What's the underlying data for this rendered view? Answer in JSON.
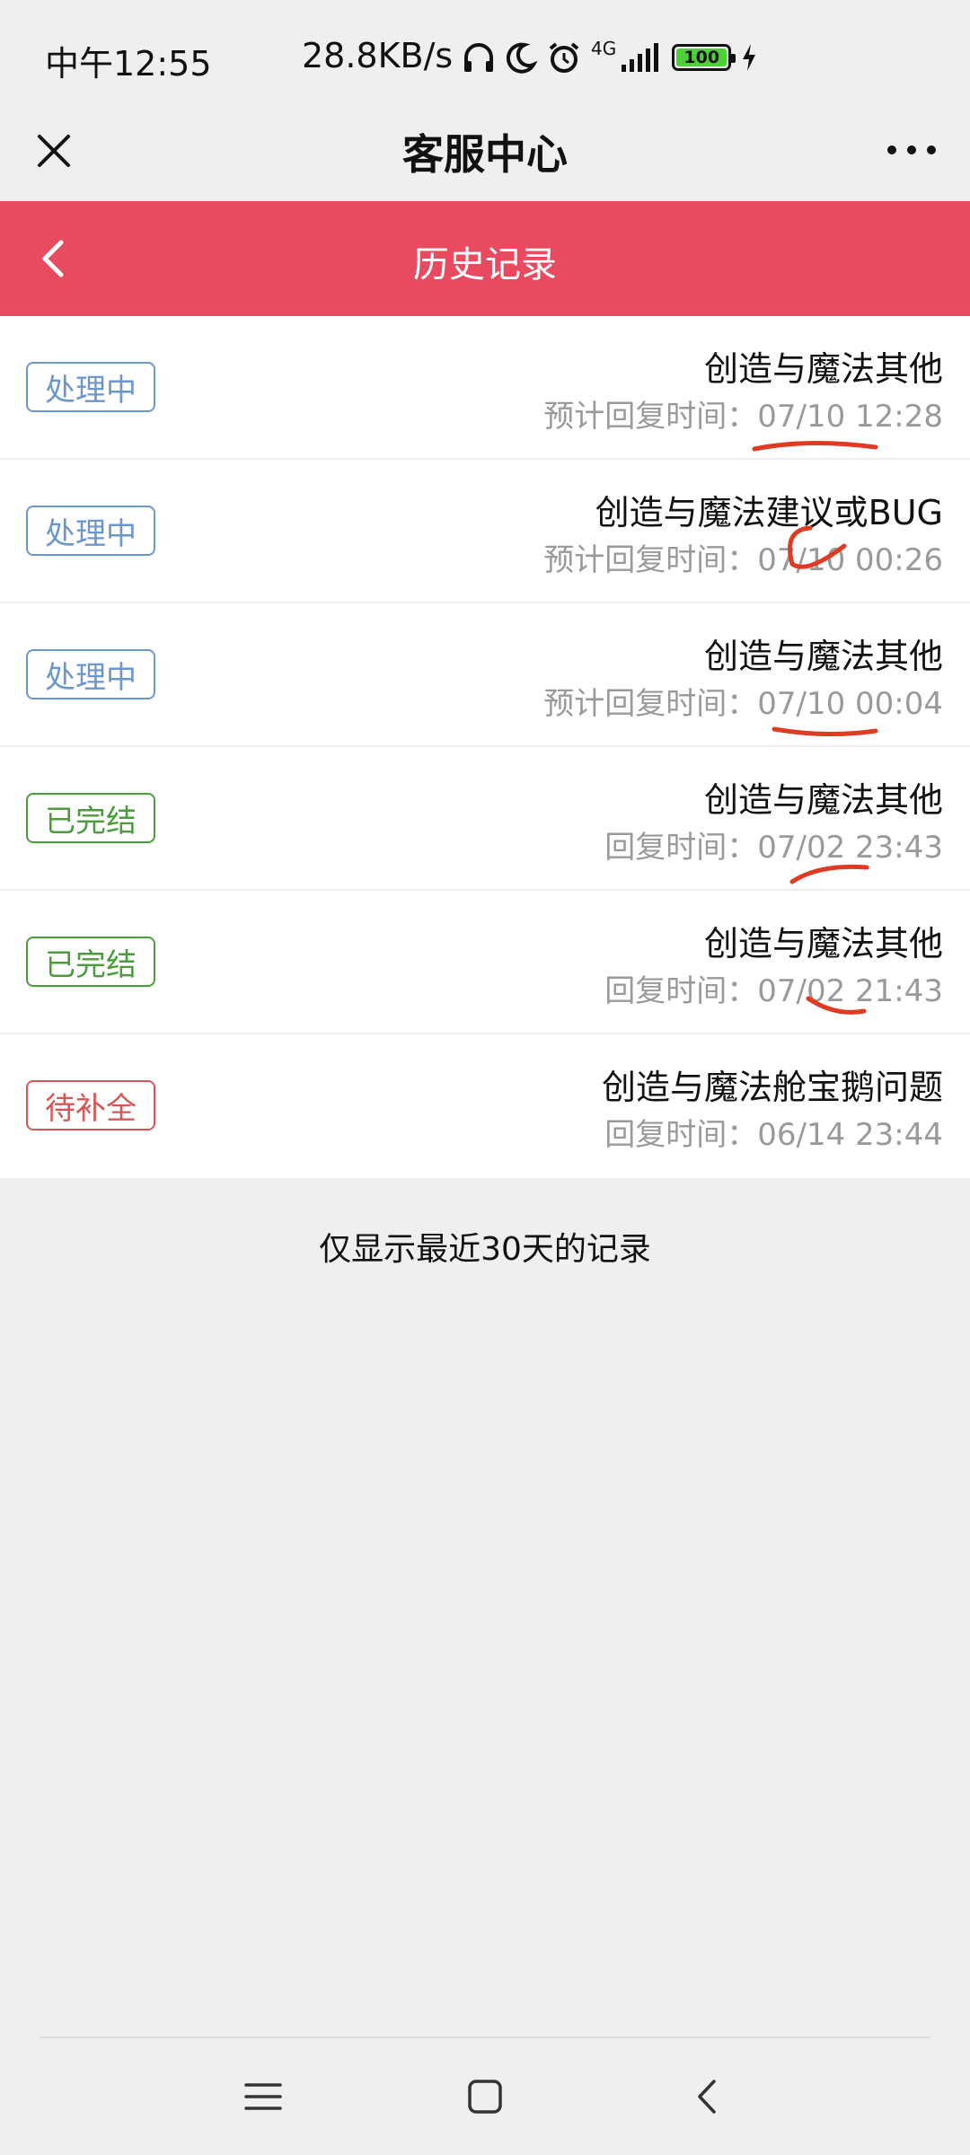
{
  "status_bar": {
    "time": "中午12:55",
    "speed": "28.8KB/s",
    "network": "4G",
    "battery": "100"
  },
  "nav": {
    "title": "客服中心"
  },
  "header": {
    "title": "历史记录"
  },
  "tickets": [
    {
      "status": "处理中",
      "status_type": "processing",
      "title": "创造与魔法其他",
      "reply_label": "预计回复时间：",
      "reply_time": "07/10 12:28"
    },
    {
      "status": "处理中",
      "status_type": "processing",
      "title": "创造与魔法建议或BUG",
      "reply_label": "预计回复时间：",
      "reply_time": "07/10 00:26"
    },
    {
      "status": "处理中",
      "status_type": "processing",
      "title": "创造与魔法其他",
      "reply_label": "预计回复时间：",
      "reply_time": "07/10 00:04"
    },
    {
      "status": "已完结",
      "status_type": "done",
      "title": "创造与魔法其他",
      "reply_label": "回复时间：",
      "reply_time": "07/02 23:43"
    },
    {
      "status": "已完结",
      "status_type": "done",
      "title": "创造与魔法其他",
      "reply_label": "回复时间：",
      "reply_time": "07/02 21:43"
    },
    {
      "status": "待补全",
      "status_type": "pending",
      "title": "创造与魔法舱宝鹅问题",
      "reply_label": "回复时间：",
      "reply_time": "06/14 23:44"
    }
  ],
  "footer_note": "仅显示最近30天的记录",
  "colors": {
    "header_bg": "#e84a5f",
    "processing": "#6b97d1",
    "done": "#4a9e3a",
    "pending": "#d75555",
    "annotation": "#e03a22"
  },
  "icons": {
    "close": "close-icon",
    "more": "more-icon",
    "back": "chevron-left-icon",
    "menu": "menu-icon",
    "home": "home-icon",
    "system_back": "system-back-icon"
  }
}
